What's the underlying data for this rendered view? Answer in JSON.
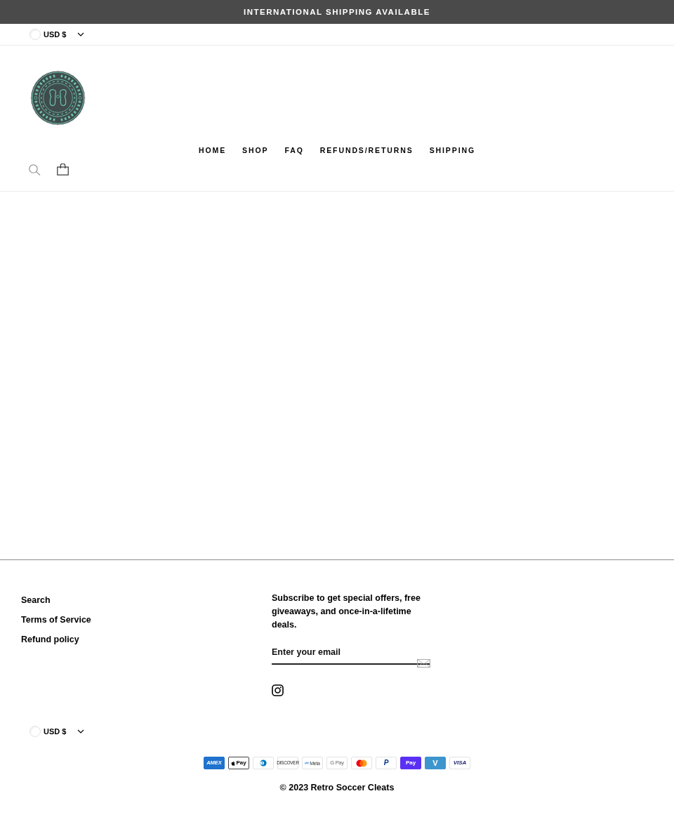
{
  "announcement": {
    "text": "INTERNATIONAL SHIPPING AVAILABLE"
  },
  "currency_selector": {
    "label": "USD $"
  },
  "nav": [
    {
      "label": "HOME"
    },
    {
      "label": "SHOP"
    },
    {
      "label": "FAQ"
    },
    {
      "label": "REFUNDS/RETURNS"
    },
    {
      "label": "SHIPPING"
    }
  ],
  "footer": {
    "links": [
      {
        "label": "Search"
      },
      {
        "label": "Terms of Service"
      },
      {
        "label": "Refund policy"
      }
    ],
    "newsletter": {
      "text": "Subscribe to get special offers, free giveaways, and once-in-a-lifetime deals.",
      "placeholder": "Enter your email"
    },
    "currency_selector": {
      "label": "USD $"
    },
    "payment_methods": [
      {
        "kind": "amex",
        "label": "AMEX"
      },
      {
        "kind": "applepay",
        "label": "Pay"
      },
      {
        "kind": "diners"
      },
      {
        "kind": "discover",
        "label": "DISCOVER"
      },
      {
        "kind": "meta",
        "label": "Meta"
      },
      {
        "kind": "googlepay",
        "label": "G Pay"
      },
      {
        "kind": "mastercard"
      },
      {
        "kind": "paypal",
        "label": "P"
      },
      {
        "kind": "shoppay",
        "label": "Pay"
      },
      {
        "kind": "venmo",
        "label": "V"
      },
      {
        "kind": "visa",
        "label": "VISA"
      }
    ],
    "copyright": "© 2023 Retro Soccer Cleats"
  }
}
